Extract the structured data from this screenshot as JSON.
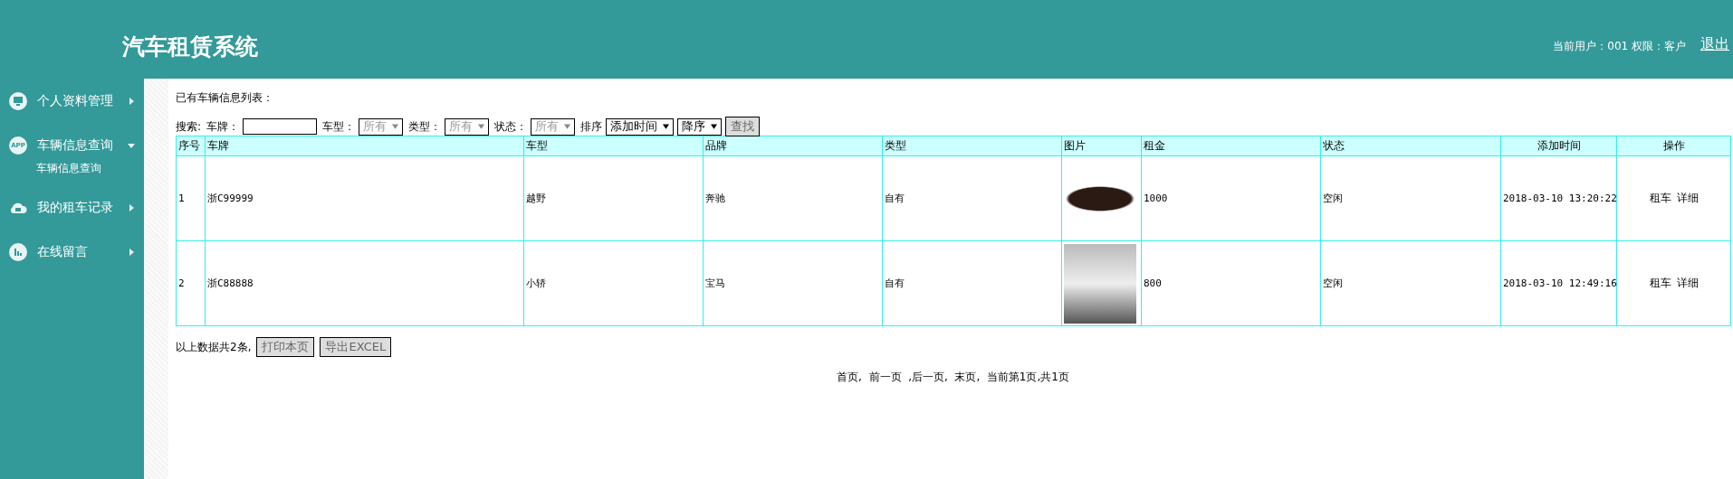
{
  "header": {
    "title": "汽车租赁系统",
    "user_info": "当前用户：001  权限：客户",
    "logout": "退出"
  },
  "sidebar": {
    "items": [
      {
        "label": "个人资料管理",
        "expanded": false
      },
      {
        "label": "车辆信息查询",
        "icon_text": "APP",
        "expanded": true,
        "children": [
          {
            "label": "车辆信息查询"
          }
        ]
      },
      {
        "label": "我的租车记录",
        "expanded": false
      },
      {
        "label": "在线留言",
        "expanded": false
      }
    ]
  },
  "heading": "已有车辆信息列表：",
  "search": {
    "label": "搜索:",
    "filters": [
      {
        "kind": "input",
        "label": "车牌："
      },
      {
        "kind": "select",
        "label": "车型：",
        "value": "所有",
        "disabled": true
      },
      {
        "kind": "select",
        "label": "类型：",
        "value": "所有",
        "disabled": true
      },
      {
        "kind": "select",
        "label": "状态：",
        "value": "所有",
        "disabled": true
      },
      {
        "kind": "select",
        "label": "排序",
        "value": "添加时间",
        "disabled": false
      },
      {
        "kind": "select",
        "value": "降序",
        "disabled": false
      }
    ],
    "button": "查找"
  },
  "table": {
    "columns": [
      "序号",
      "车牌",
      "车型",
      "品牌",
      "类型",
      "图片",
      "租金",
      "状态",
      "添加时间",
      "操作"
    ],
    "rows": [
      {
        "no": "1",
        "plate": "浙C99999",
        "model": "越野",
        "brand": "奔驰",
        "type": "自有",
        "rent": "1000",
        "status": "空闲",
        "added": "2018-03-10 13:20:22",
        "actions": [
          "租车",
          "详细"
        ]
      },
      {
        "no": "2",
        "plate": "浙C88888",
        "model": "小轿",
        "brand": "宝马",
        "type": "自有",
        "rent": "800",
        "status": "空闲",
        "added": "2018-03-10 12:49:16",
        "actions": [
          "租车",
          "详细"
        ]
      }
    ]
  },
  "footer": {
    "summary": "以上数据共2条,",
    "buttons": [
      "打印本页",
      "导出EXCEL"
    ]
  },
  "pagination": "首页,  前一页  ,后一页,  末页,  当前第1页,共1页"
}
